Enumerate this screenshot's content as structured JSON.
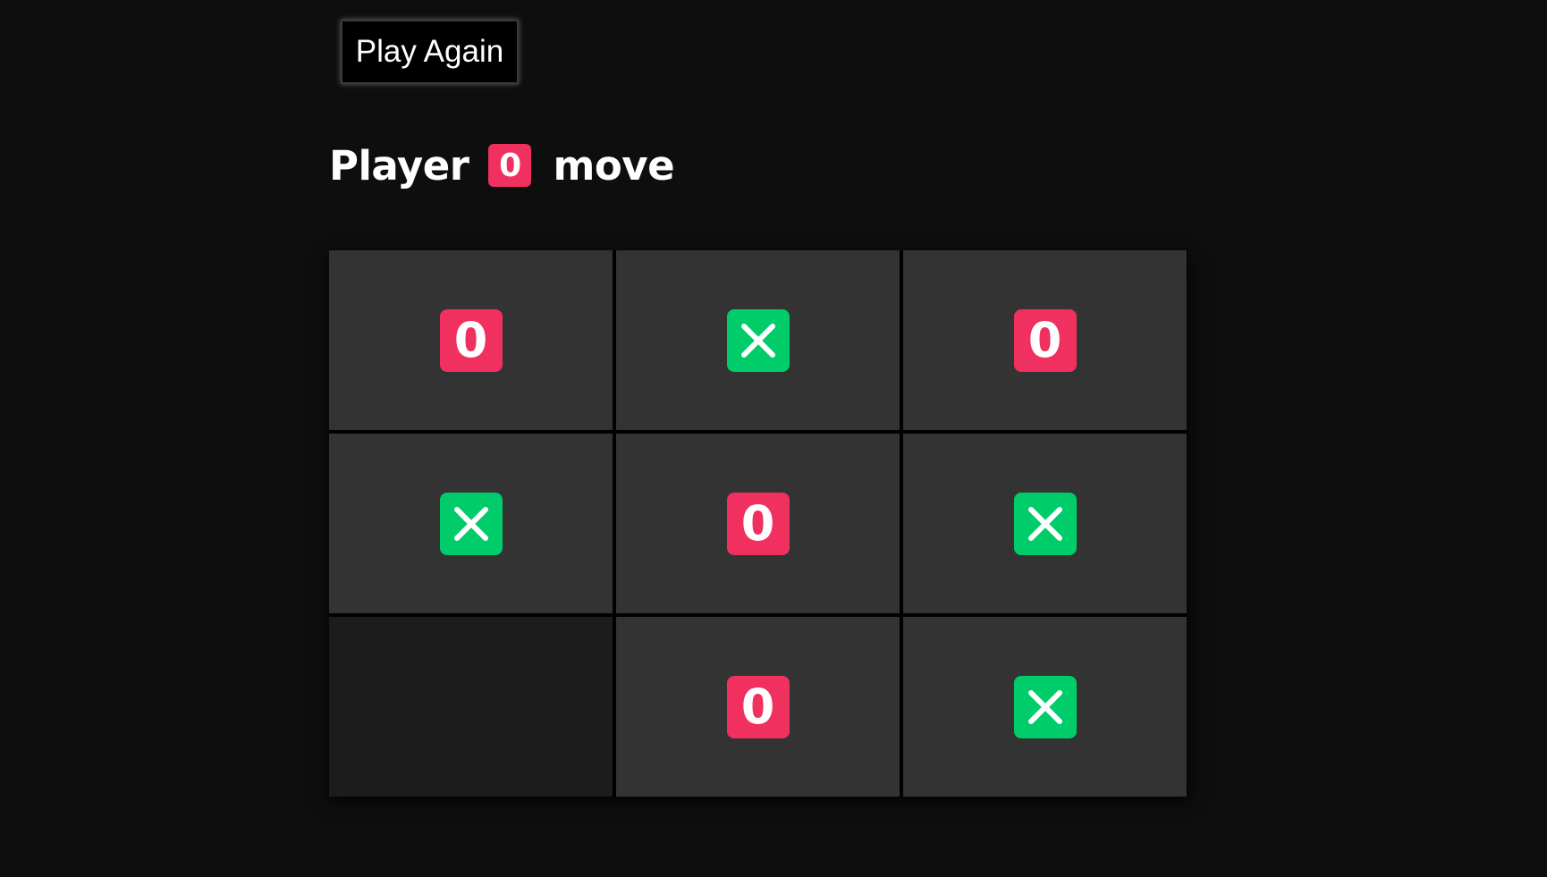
{
  "header": {
    "play_again_label": "Play Again"
  },
  "status": {
    "prefix": "Player",
    "current_player": "0",
    "suffix": "move"
  },
  "board": {
    "cells": [
      "0",
      "X",
      "0",
      "X",
      "0",
      "X",
      "",
      "0",
      "X"
    ]
  },
  "colors": {
    "o_badge": "#f0305f",
    "x_badge": "#00cc6a",
    "cell": "#333333",
    "empty_cell": "#1c1c1c",
    "background": "#0e0e0e"
  },
  "icons": {
    "x_mark": "x-icon"
  }
}
